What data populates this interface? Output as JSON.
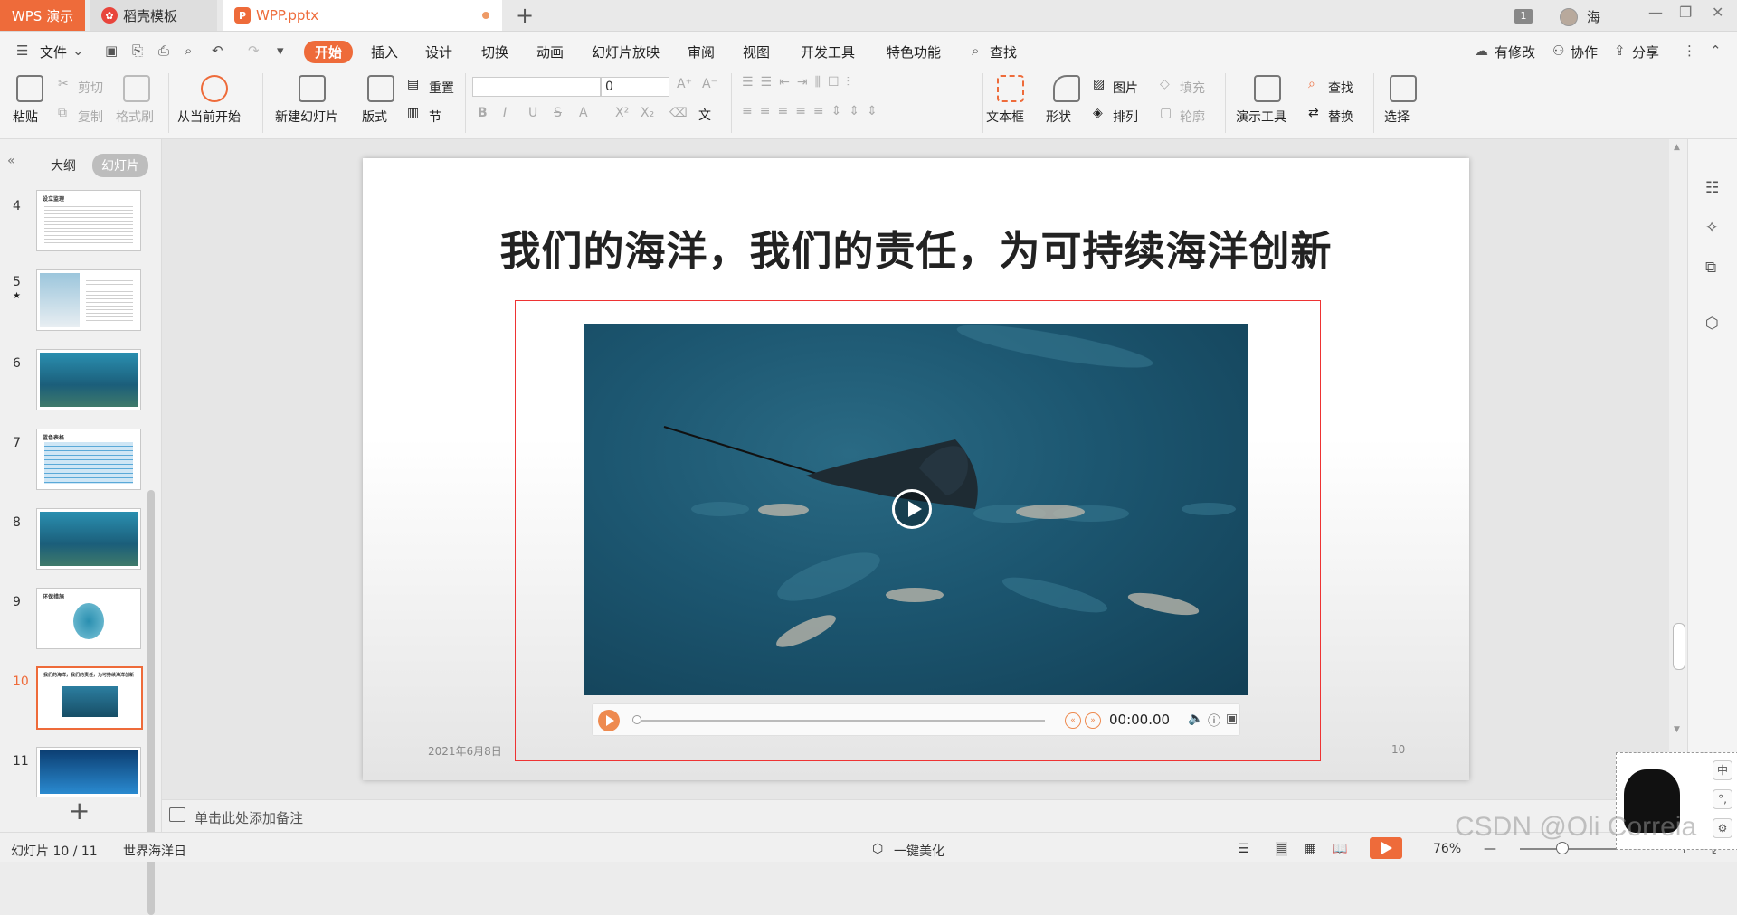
{
  "titlebar": {
    "app_tab": "WPS 演示",
    "tabs": [
      {
        "label": "稻壳模板",
        "icon": "daoke-logo-icon"
      },
      {
        "label": "WPP.pptx",
        "icon": "wpp-logo-icon"
      }
    ],
    "badge_count": "1",
    "user_name": "海"
  },
  "menubar": {
    "file": "文件",
    "tabs": [
      "开始",
      "插入",
      "设计",
      "切换",
      "动画",
      "幻灯片放映",
      "审阅",
      "视图",
      "开发工具",
      "特色功能"
    ],
    "active_tab": "开始",
    "search": "查找",
    "right": {
      "changes": "有修改",
      "collab": "协作",
      "share": "分享"
    }
  },
  "ribbon": {
    "paste": "粘贴",
    "cut": "剪切",
    "copy": "复制",
    "format_painter": "格式刷",
    "from_current": "从当前开始",
    "new_slide": "新建幻灯片",
    "layout": "版式",
    "reset": "重置",
    "section": "节",
    "font_name": "",
    "font_size": "0",
    "textbox": "文本框",
    "shape": "形状",
    "picture": "图片",
    "arrange": "排列",
    "fill": "填充",
    "outline": "轮廓",
    "present_tools": "演示工具",
    "find": "查找",
    "replace": "替换",
    "select": "选择"
  },
  "leftpanel": {
    "tab_outline": "大纲",
    "tab_slides": "幻灯片",
    "thumbs": [
      {
        "num": "4",
        "title": "设立监理",
        "kind": "text"
      },
      {
        "num": "5",
        "title": "",
        "kind": "bear"
      },
      {
        "num": "6",
        "title": "",
        "kind": "ocean"
      },
      {
        "num": "7",
        "title": "蓝色表格",
        "kind": "table"
      },
      {
        "num": "8",
        "title": "",
        "kind": "ocean"
      },
      {
        "num": "9",
        "title": "环保措施",
        "kind": "diagram"
      },
      {
        "num": "10",
        "title": "我们的海洋，我们的责任，为可持续海洋创新",
        "kind": "video"
      },
      {
        "num": "11",
        "title": "",
        "kind": "ocean"
      }
    ],
    "selected": "10"
  },
  "slide": {
    "title": "我们的海洋，我们的责任，为可持续海洋创新",
    "date": "2021年6月8日",
    "number": "10",
    "player_time": "00:00.00"
  },
  "notes": {
    "placeholder": "单击此处添加备注"
  },
  "statusbar": {
    "slide_index": "幻灯片 10 / 11",
    "theme": "世界海洋日",
    "beautify": "一键美化",
    "zoom": "76%"
  },
  "ime": {
    "mode": "中",
    "punct": "°,"
  },
  "watermark": "CSDN @Oli Correia"
}
